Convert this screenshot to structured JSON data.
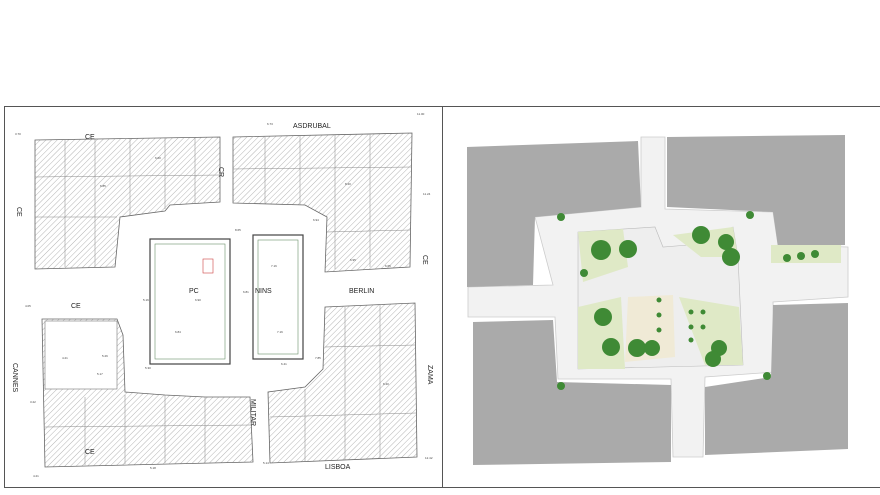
{
  "left_plan": {
    "street_labels": {
      "ce_top": "CE",
      "asdrubal": "ASDRUBAL",
      "cr": "CR",
      "ce_left": "CE",
      "ce_mid_left": "CE",
      "ce_right": "CE",
      "berlin": "BERLIN",
      "cannes": "CANNES",
      "zama": "ZAMA",
      "militar": "MILITAR",
      "ce_bottom": "CE",
      "lisboa": "LISBOA"
    },
    "block_labels": {
      "pc": "PC",
      "nins": "NINS"
    },
    "elevations": {
      "e1": "3.70",
      "e2": "11.00",
      "e3": "6.73",
      "e4": "6.00",
      "e5": "8.40",
      "e6": "6.85",
      "e7": "6.95",
      "e8": "6.94",
      "e9": "7.16",
      "e10": "6.65",
      "e11": "6.90",
      "e12": "4.21",
      "e13": "5.26",
      "e14": "5.17",
      "e15": "3.22",
      "e16": "5.30",
      "e17": "7.85",
      "e18": "6.40",
      "e19": "5.18",
      "e20": "5.14",
      "e21": "12.42",
      "e22": "4.21",
      "e23": "8.65",
      "e24": "6.41",
      "e25": "11.24",
      "e26": "4.05",
      "e27": "5.16",
      "e28": "6.84",
      "e29": "6.81",
      "e30": "7.16"
    }
  },
  "right_plan": {
    "colors": {
      "building": "#aaaaaa",
      "plaza": "#f2f2f2",
      "green": "#dfe9c6",
      "tree": "#3f8a35",
      "sand": "#f0ead6"
    }
  }
}
